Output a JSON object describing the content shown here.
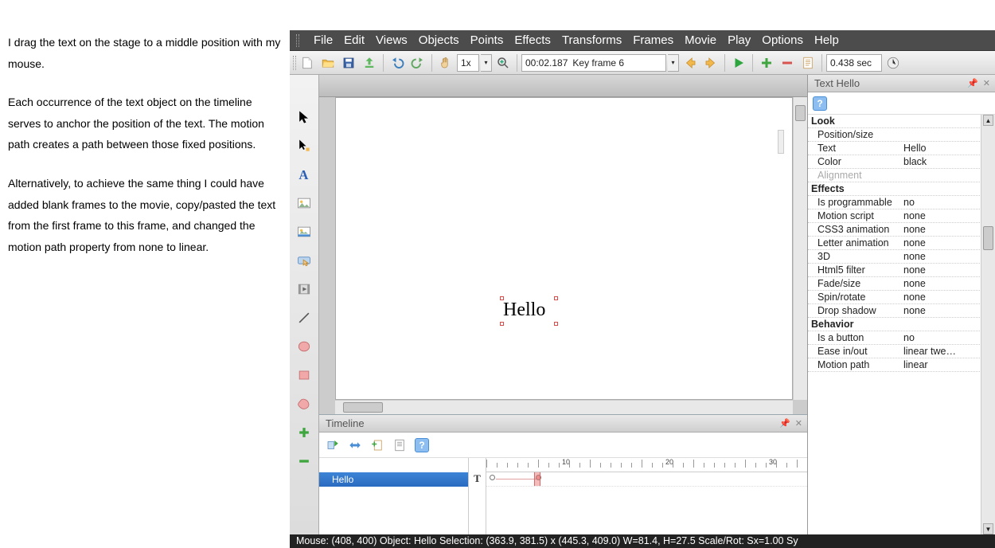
{
  "doc": {
    "p1": "I drag the text on the stage to a middle position with my mouse.",
    "p2": "Each occurrence of the text object on the timeline serves to anchor the position of the text. The motion path creates a path between those fixed positions.",
    "p3": "Alternatively, to achieve the same thing I could have added blank frames to the movie, copy/pasted the text from the first frame to this frame, and changed the motion path property from none to linear."
  },
  "menu": {
    "file": "File",
    "edit": "Edit",
    "views": "Views",
    "objects": "Objects",
    "points": "Points",
    "effects": "Effects",
    "transforms": "Transforms",
    "frames": "Frames",
    "movie": "Movie",
    "play": "Play",
    "options": "Options",
    "help": "Help"
  },
  "toolbar": {
    "zoom": "1x",
    "time": "00:02.187",
    "frame": "Key frame 6",
    "duration": "0.438 sec"
  },
  "stage": {
    "text": "Hello"
  },
  "timeline": {
    "title": "Timeline",
    "row_label": "Hello",
    "type_glyph": "T",
    "ticks": [
      10,
      20,
      30
    ]
  },
  "props": {
    "title": "Text Hello",
    "sections": {
      "look": "Look",
      "effects": "Effects",
      "behavior": "Behavior"
    },
    "rows": {
      "position_size": "Position/size",
      "text_k": "Text",
      "text_v": "Hello",
      "color_k": "Color",
      "color_v": "black",
      "alignment": "Alignment",
      "is_prog_k": "Is programmable",
      "is_prog_v": "no",
      "motion_script_k": "Motion script",
      "motion_script_v": "none",
      "css3_k": "CSS3 animation",
      "css3_v": "none",
      "letter_k": "Letter animation",
      "letter_v": "none",
      "threeD_k": "3D",
      "threeD_v": "none",
      "html5_k": "Html5 filter",
      "html5_v": "none",
      "fade_k": "Fade/size",
      "fade_v": "none",
      "spin_k": "Spin/rotate",
      "spin_v": "none",
      "drop_k": "Drop shadow",
      "drop_v": "none",
      "btn_k": "Is a button",
      "btn_v": "no",
      "ease_k": "Ease in/out",
      "ease_v": "linear twe…",
      "mpath_k": "Motion path",
      "mpath_v": "linear"
    }
  },
  "status": {
    "text": "Mouse: (408, 400)  Object: Hello  Selection: (363.9, 381.5) x (445.3, 409.0)  W=81.4,  H=27.5  Scale/Rot: Sx=1.00 Sy"
  }
}
